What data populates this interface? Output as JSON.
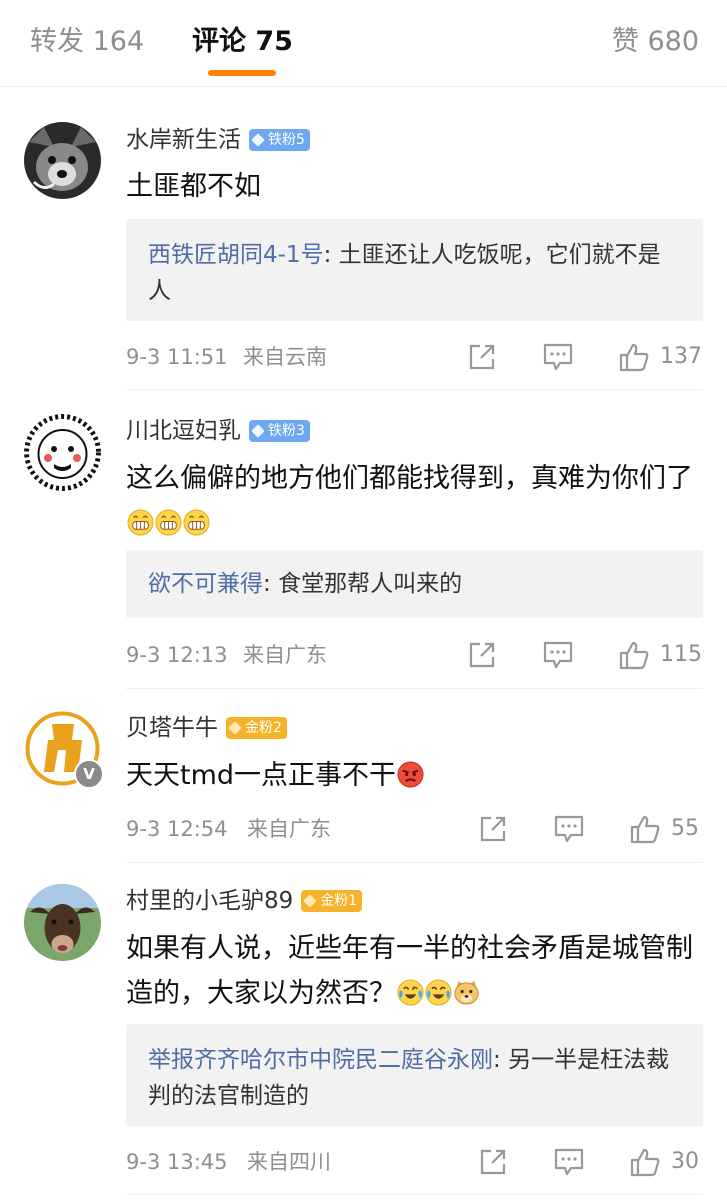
{
  "tabs": {
    "repost": "转发 164",
    "comments": "评论 75",
    "likes": "赞 680"
  },
  "colors": {
    "accent": "#ff8200",
    "link": "#4e6ea5",
    "iron_badge": "#6da8f0",
    "gold_badge": "#f6b229"
  },
  "comments": [
    {
      "username": "水岸新生活",
      "badge": "铁粉5",
      "content": "土匪都不如",
      "reply_user": "西铁匠胡同4-1号",
      "reply_text": "土匪还让人吃饭呢，它们就不是人",
      "time": "9-3 11:51",
      "location": "来自云南",
      "likes": "137",
      "avatar_icon": "wolf-photo-icon"
    },
    {
      "username": "川北逗妇乳",
      "badge": "铁粉3",
      "content": "这么偏僻的地方他们都能找得到，真难为你们了",
      "emojis": [
        "grin-emoji-icon",
        "grin-emoji-icon",
        "grin-emoji-icon"
      ],
      "reply_user": "欲不可兼得",
      "reply_text": "食堂那帮人叫来的",
      "time": "9-3 12:13",
      "location": "来自广东",
      "likes": "115",
      "avatar_icon": "cartoon-face-icon"
    },
    {
      "username": "贝塔牛牛",
      "badge": "金粉2",
      "content": "天天tmd一点正事不干",
      "emojis": [
        "angry-emoji-icon"
      ],
      "time": "9-3 12:54",
      "location": "来自广东",
      "likes": "55",
      "avatar_icon": "logo-avatar-icon",
      "verified": "V"
    },
    {
      "username": "村里的小毛驴89",
      "badge": "金粉1",
      "content": "如果有人说，近些年有一半的社会矛盾是城管制造的，大家以为然否？",
      "emojis": [
        "laugh-cry-emoji-icon",
        "laugh-cry-emoji-icon",
        "doge-emoji-icon"
      ],
      "reply_user": "举报齐齐哈尔市中院民二庭谷永刚",
      "reply_text": "另一半是枉法裁判的法官制造的",
      "time": "9-3 13:45",
      "location": "来自四川",
      "likes": "30",
      "avatar_icon": "cow-photo-icon"
    }
  ]
}
